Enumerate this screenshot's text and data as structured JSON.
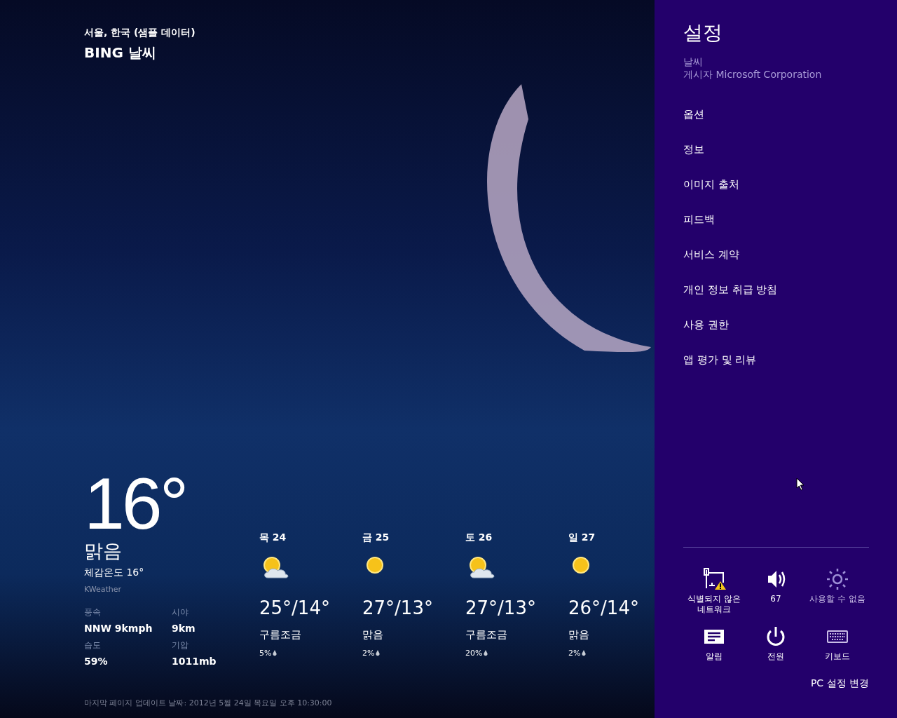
{
  "app": {
    "location": "서울, 한국 (샘플 데이터)",
    "title": "BING 날씨"
  },
  "current": {
    "temperature": "16°",
    "condition": "맑음",
    "feels_like": "체감온도 16°",
    "provider": "KWeather",
    "details": [
      {
        "label": "풍속",
        "value": "NNW 9kmph"
      },
      {
        "label": "시야",
        "value": "9km"
      },
      {
        "label": "습도",
        "value": "59%"
      },
      {
        "label": "기압",
        "value": "1011mb"
      }
    ]
  },
  "forecast": [
    {
      "day": "목 24",
      "kind": "partly-cloudy",
      "temps": "25°/14°",
      "condition": "구름조금",
      "precip": "5%"
    },
    {
      "day": "금 25",
      "kind": "sunny",
      "temps": "27°/13°",
      "condition": "맑음",
      "precip": "2%"
    },
    {
      "day": "토 26",
      "kind": "partly-cloudy",
      "temps": "27°/13°",
      "condition": "구름조금",
      "precip": "20%"
    },
    {
      "day": "일 27",
      "kind": "sunny",
      "temps": "26°/14°",
      "condition": "맑음",
      "precip": "2%"
    }
  ],
  "last_updated": "마지막 페이지 업데이트 날짜: 2012년 5월 24일 목요일 오후 10:30:00",
  "settings": {
    "title": "설정",
    "app_name": "날씨",
    "publisher": "게시자 Microsoft Corporation",
    "items": [
      "옵션",
      "정보",
      "이미지 출처",
      "피드백",
      "서비스 계약",
      "개인 정보 취급 방침",
      "사용 권한",
      "앱 평가 및 리뷰"
    ],
    "quick": [
      {
        "kind": "network",
        "label": "식별되지 않은 네트워크",
        "disabled": false
      },
      {
        "kind": "volume",
        "label": "67",
        "disabled": false
      },
      {
        "kind": "brightness",
        "label": "사용할 수 없음",
        "disabled": true
      },
      {
        "kind": "notifications",
        "label": "알림",
        "disabled": false
      },
      {
        "kind": "power",
        "label": "전원",
        "disabled": false
      },
      {
        "kind": "keyboard",
        "label": "키보드",
        "disabled": false
      }
    ],
    "pc_settings": "PC 설정 변경"
  }
}
